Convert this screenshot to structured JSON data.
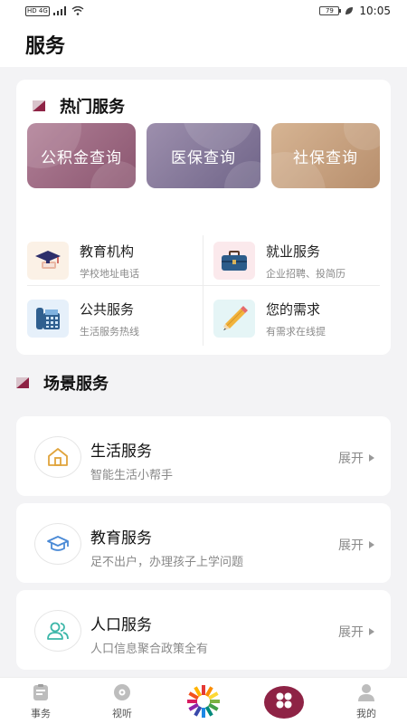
{
  "status_bar": {
    "network": "HD 4G",
    "battery": "79",
    "time": "10:05"
  },
  "header": {
    "title": "服务"
  },
  "hot": {
    "title": "热门服务",
    "quick_buttons": [
      {
        "label": "公积金查询"
      },
      {
        "label": "医保查询"
      },
      {
        "label": "社保查询"
      }
    ],
    "items": [
      {
        "title": "教育机构",
        "subtitle": "学校地址电话",
        "icon": "graduation-cap-icon"
      },
      {
        "title": "就业服务",
        "subtitle": "企业招聘、投简历",
        "icon": "briefcase-icon"
      },
      {
        "title": "公共服务",
        "subtitle": "生活服务热线",
        "icon": "telephone-icon"
      },
      {
        "title": "您的需求",
        "subtitle": "有需求在线提",
        "icon": "pencil-icon"
      }
    ]
  },
  "scene": {
    "title": "场景服务",
    "cards": [
      {
        "title": "生活服务",
        "subtitle": "智能生活小帮手",
        "expand": "展开",
        "icon": "home-icon"
      },
      {
        "title": "教育服务",
        "subtitle": "足不出户，办理孩子上学问题",
        "expand": "展开",
        "icon": "mortarboard-icon"
      },
      {
        "title": "人口服务",
        "subtitle": "人口信息聚合政策全有",
        "expand": "展开",
        "icon": "people-icon"
      }
    ]
  },
  "tabbar": {
    "tabs": [
      {
        "label": "事务",
        "icon": "clipboard-icon"
      },
      {
        "label": "视听",
        "icon": "disc-icon"
      },
      {
        "label": "",
        "icon": "logo-star-icon"
      },
      {
        "label": "",
        "icon": "services-grid-icon"
      },
      {
        "label": "我的",
        "icon": "user-icon"
      }
    ]
  },
  "colors": {
    "accent": "#8e2345",
    "page_bg": "#f3f3f5"
  }
}
